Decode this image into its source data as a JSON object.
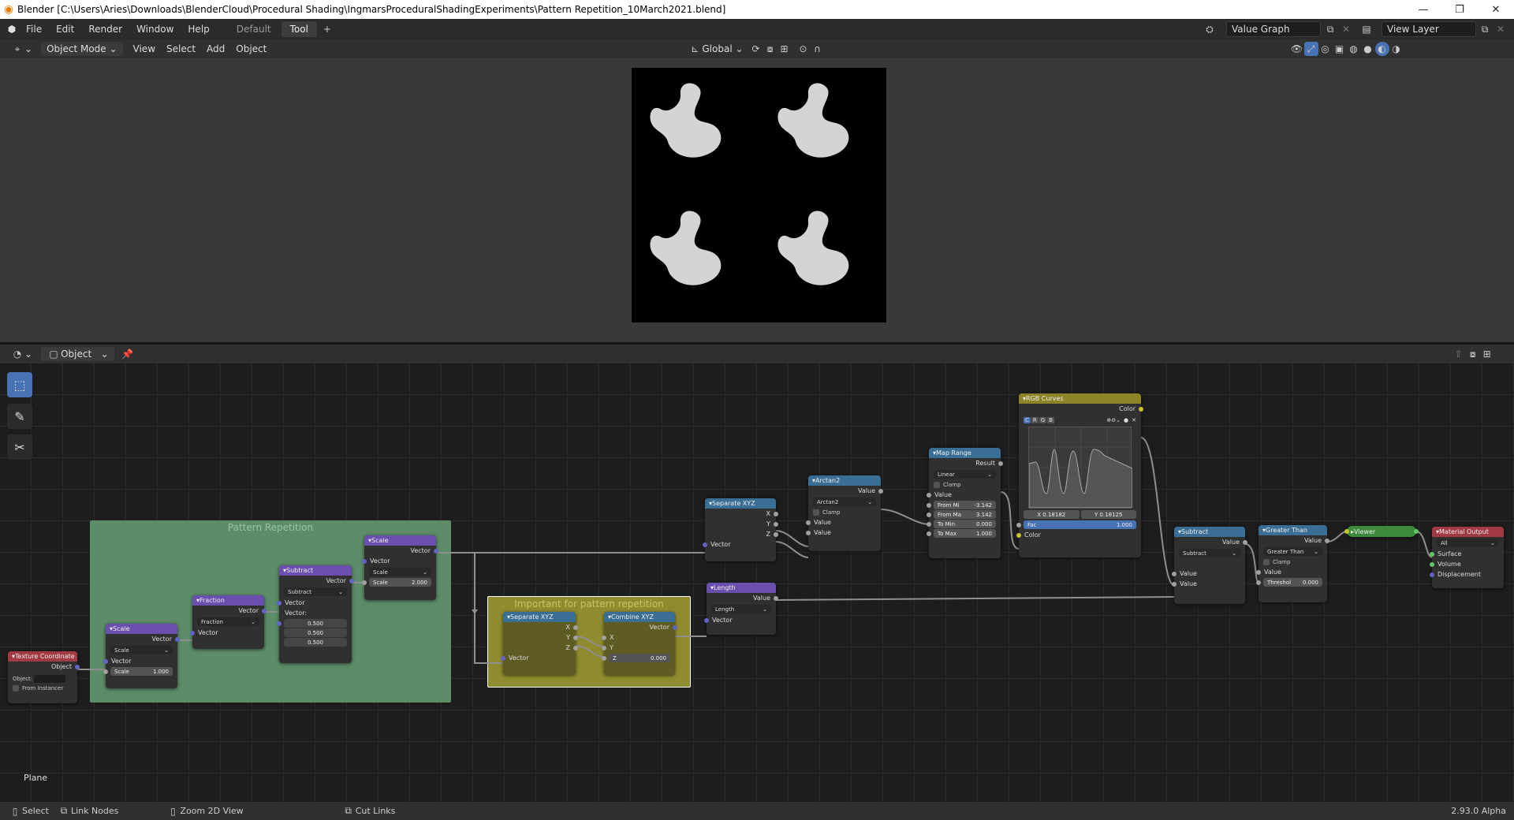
{
  "window": {
    "title": "Blender [C:\\Users\\Aries\\Downloads\\BlenderCloud\\Procedural Shading\\IngmarsProceduralShadingExperiments\\Pattern Repetition_10March2021.blend]"
  },
  "menu": {
    "items": [
      "File",
      "Edit",
      "Render",
      "Window",
      "Help"
    ],
    "workspaces": [
      "Default",
      "Tool"
    ],
    "scene": "Value Graph",
    "view_layer": "View Layer"
  },
  "viewport_header": {
    "mode": "Object Mode",
    "menus": [
      "View",
      "Select",
      "Add",
      "Object"
    ],
    "orientation": "Global"
  },
  "node_header": {
    "type": "Object"
  },
  "object_name": "Plane",
  "frames": {
    "pattern": "Pattern Repetition",
    "important": "Important for pattern repetition"
  },
  "nodes": {
    "texcoord": {
      "title": "Texture Coordinate",
      "out": "Object",
      "object_label": "Object:",
      "from_instancer": "From Instancer"
    },
    "scale1": {
      "title": "Scale",
      "out": "Vector",
      "op": "Scale",
      "in": "Vector",
      "scale_label": "Scale",
      "scale": "1.000"
    },
    "fraction": {
      "title": "Fraction",
      "out": "Vector",
      "op": "Fraction",
      "in": "Vector"
    },
    "subtract": {
      "title": "Subtract",
      "out": "Vector",
      "op": "Subtract",
      "in": "Vector",
      "in2": "Vector:",
      "v1": "0.500",
      "v2": "0.500",
      "v3": "0.500"
    },
    "scale2": {
      "title": "Scale",
      "out": "Vector",
      "op": "Scale",
      "in": "Vector",
      "scale_label": "Scale",
      "scale": "2.000"
    },
    "sepxyz1": {
      "title": "Separate XYZ",
      "x": "X",
      "y": "Y",
      "z": "Z",
      "in": "Vector"
    },
    "combxyz": {
      "title": "Combine XYZ",
      "out": "Vector",
      "x": "X",
      "y": "Y",
      "z_label": "Z",
      "z": "0.000"
    },
    "length": {
      "title": "Length",
      "out": "Value",
      "op": "Length",
      "in": "Vector"
    },
    "sepxyz2": {
      "title": "Separate XYZ",
      "x": "X",
      "y": "Y",
      "z": "Z",
      "in": "Vector"
    },
    "arctan": {
      "title": "Arctan2",
      "out": "Value",
      "op": "Arctan2",
      "clamp": "Clamp",
      "in1": "Value",
      "in2": "Value"
    },
    "maprange": {
      "title": "Map Range",
      "out": "Result",
      "op": "Linear",
      "clamp": "Clamp",
      "in": "Value",
      "from_min_l": "From Mi",
      "from_min": "-3.142",
      "from_max_l": "From Ma",
      "from_max": "3.142",
      "to_min_l": "To Min",
      "to_min": "0.000",
      "to_max_l": "To Max",
      "to_max": "1.000"
    },
    "curves": {
      "title": "RGB Curves",
      "out": "Color",
      "ch": [
        "C",
        "R",
        "G",
        "B"
      ],
      "xr": "X 0.18182",
      "yr": "Y 0.18125",
      "fac_l": "Fac",
      "fac": "1.000",
      "in": "Color"
    },
    "subtract2": {
      "title": "Subtract",
      "out": "Value",
      "op": "Subtract",
      "in1": "Value",
      "in2": "Value"
    },
    "greater": {
      "title": "Greater Than",
      "out": "Value",
      "op": "Greater Than",
      "clamp": "Clamp",
      "in": "Value",
      "thr_l": "Threshol",
      "thr": "0.000"
    },
    "viewer": {
      "title": "Viewer"
    },
    "matout": {
      "title": "Material Output",
      "target": "All",
      "s1": "Surface",
      "s2": "Volume",
      "s3": "Displacement"
    }
  },
  "status": {
    "select": "Select",
    "link": "Link Nodes",
    "zoom": "Zoom 2D View",
    "cut": "Cut Links",
    "version": "2.93.0 Alpha"
  }
}
